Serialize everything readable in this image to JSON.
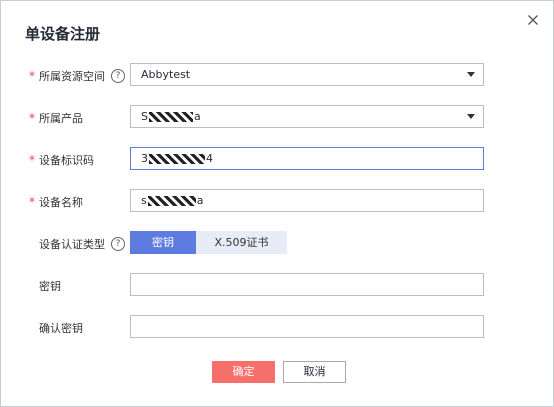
{
  "dialog": {
    "title": "单设备注册",
    "close_icon": "close-icon"
  },
  "form": {
    "resource_space": {
      "label": "所属资源空间",
      "value": "Abbytest",
      "required": true,
      "help_icon": "question-circle-icon"
    },
    "product": {
      "label": "所属产品",
      "value_prefix": "S",
      "value_suffix": "a",
      "required": true
    },
    "device_id": {
      "label": "设备标识码",
      "value_prefix": "3",
      "value_suffix": "4",
      "required": true
    },
    "device_name": {
      "label": "设备名称",
      "value_prefix": "s",
      "value_suffix": "a",
      "required": true
    },
    "auth_type": {
      "label": "设备认证类型",
      "help_icon": "question-circle-icon",
      "options": [
        "密钥",
        "X.509证书"
      ],
      "selected": "密钥"
    },
    "secret": {
      "label": "密钥",
      "value": ""
    },
    "confirm_secret": {
      "label": "确认密钥",
      "value": ""
    }
  },
  "footer": {
    "ok_label": "确定",
    "cancel_label": "取消"
  },
  "colors": {
    "primary": "#5e7ce0",
    "danger": "#f66f6a",
    "required": "#e04b3f"
  }
}
